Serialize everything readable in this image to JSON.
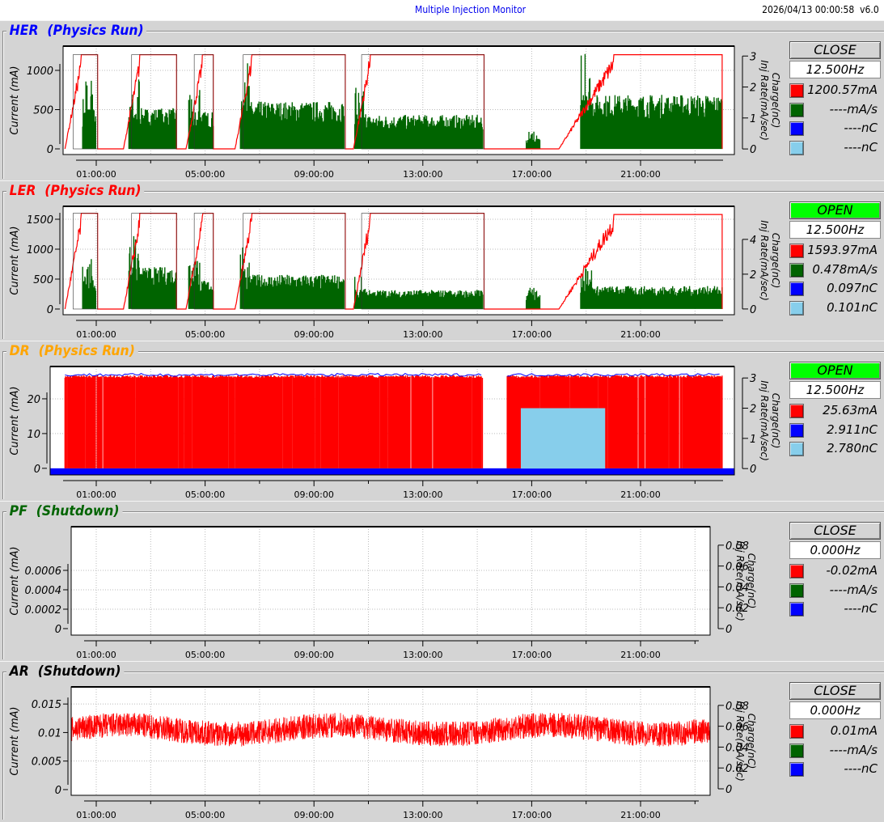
{
  "header": {
    "title": "Multiple Injection Monitor",
    "timestamp": "2026/04/13 00:00:58",
    "version": "v6.0"
  },
  "colors": {
    "current": "#ff0000",
    "inj_rate": "#006400",
    "charge": "#0000ff",
    "charge2": "#87ceeb"
  },
  "time_ticks": [
    {
      "t": 1,
      "label": "01:00:00"
    },
    {
      "t": 5,
      "label": "05:00:00"
    },
    {
      "t": 9,
      "label": "09:00:00"
    },
    {
      "t": 13,
      "label": "13:00:00"
    },
    {
      "t": 17,
      "label": "17:00:00"
    },
    {
      "t": 21,
      "label": "21:00:00"
    }
  ],
  "axis_labels": {
    "left": "Current (mA)",
    "right1": "Charge(nC)",
    "right2": "Inj Rate(mA/sec)"
  },
  "panels": [
    {
      "id": "her",
      "name": "HER",
      "status": "(Physics Run)",
      "color": "#0000ff",
      "state": "CLOSE",
      "freq": "12.500Hz",
      "ylim": [
        -72,
        1309
      ],
      "y2lim": [
        -0.18,
        3.32
      ],
      "yticks": [
        {
          "v": 0,
          "l": "0"
        },
        {
          "v": 500,
          "l": "500"
        },
        {
          "v": 1000,
          "l": "1000"
        }
      ],
      "y2ticks": [
        {
          "v": 0,
          "l": "0"
        },
        {
          "v": 1,
          "l": "1"
        },
        {
          "v": 2,
          "l": "2"
        },
        {
          "v": 3,
          "l": "3"
        }
      ],
      "legend": [
        {
          "color": "#ff0000",
          "value": "1200.57mA"
        },
        {
          "color": "#006400",
          "value": "----mA/s"
        },
        {
          "color": "#0000ff",
          "value": "----nC"
        },
        {
          "color": "#87ceeb",
          "value": "----nC"
        }
      ],
      "fills": [
        [
          -0.15,
          1.05,
          1200
        ],
        [
          2.0,
          3.95,
          1200
        ],
        [
          4.3,
          5.3,
          1200
        ],
        [
          6.1,
          10.15,
          1200
        ],
        [
          10.45,
          15.25,
          1200
        ],
        [
          18.0,
          24.0,
          1200
        ]
      ],
      "inj": [
        [
          0.5,
          1.0,
          1.2
        ],
        [
          2.2,
          3.95,
          1.2
        ],
        [
          4.4,
          5.3,
          1.1
        ],
        [
          6.3,
          10.1,
          1.4
        ],
        [
          10.5,
          15.2,
          1.0
        ],
        [
          16.8,
          17.3,
          0.3
        ],
        [
          18.8,
          24.0,
          1.6
        ]
      ],
      "charge": [
        [
          15.3,
          19.8,
          0.1
        ]
      ]
    },
    {
      "id": "ler",
      "name": "LER",
      "status": "(Physics Run)",
      "color": "#ff0000",
      "state": "OPEN",
      "freq": "12.500Hz",
      "ylim": [
        -95,
        1716
      ],
      "y2lim": [
        -0.33,
        5.9
      ],
      "yticks": [
        {
          "v": 0,
          "l": "0"
        },
        {
          "v": 500,
          "l": "500"
        },
        {
          "v": 1000,
          "l": "1000"
        },
        {
          "v": 1500,
          "l": "1500"
        }
      ],
      "y2ticks": [
        {
          "v": 0,
          "l": "0"
        },
        {
          "v": 2,
          "l": "2"
        },
        {
          "v": 4,
          "l": "4"
        }
      ],
      "legend": [
        {
          "color": "#ff0000",
          "value": "1593.97mA"
        },
        {
          "color": "#006400",
          "value": "0.478mA/s"
        },
        {
          "color": "#0000ff",
          "value": "0.097nC"
        },
        {
          "color": "#87ceeb",
          "value": "0.101nC"
        }
      ],
      "fills": [
        [
          -0.15,
          1.05,
          1600
        ],
        [
          2.0,
          3.95,
          1600
        ],
        [
          4.3,
          5.3,
          1600
        ],
        [
          6.1,
          10.15,
          1600
        ],
        [
          10.45,
          15.25,
          1600
        ],
        [
          18.0,
          24.0,
          1580
        ]
      ],
      "inj": [
        [
          0.5,
          1.0,
          1.5
        ],
        [
          2.2,
          3.95,
          2.2
        ],
        [
          4.4,
          5.3,
          1.5
        ],
        [
          6.3,
          10.1,
          1.8
        ],
        [
          10.5,
          15.2,
          1.0
        ],
        [
          16.8,
          17.3,
          0.8
        ],
        [
          18.8,
          24.0,
          1.2
        ]
      ],
      "charge": [
        [
          15.9,
          17.4,
          0.2
        ],
        [
          23.6,
          24.0,
          0.6
        ]
      ]
    },
    {
      "id": "dr",
      "name": "DR",
      "status": "(Physics Run)",
      "color": "#ffa500",
      "state": "OPEN",
      "freq": "12.500Hz",
      "ylim": [
        -1.9,
        29.3
      ],
      "y2lim": [
        -0.21,
        3.38
      ],
      "yticks": [
        {
          "v": 0,
          "l": "0"
        },
        {
          "v": 10,
          "l": "10"
        },
        {
          "v": 20,
          "l": "20"
        }
      ],
      "y2ticks": [
        {
          "v": 0,
          "l": "0"
        },
        {
          "v": 1,
          "l": "1"
        },
        {
          "v": 2,
          "l": "2"
        },
        {
          "v": 3,
          "l": "3"
        }
      ],
      "legend": [
        {
          "color": "#ff0000",
          "value": "25.63mA"
        },
        {
          "color": "#0000ff",
          "value": "2.911nC"
        },
        {
          "color": "#87ceeb",
          "value": "2.780nC"
        }
      ],
      "dr_fills": [
        [
          -0.15,
          15.2,
          26
        ],
        [
          16.1,
          24.0,
          26
        ]
      ],
      "dr_charge2": [
        [
          16.6,
          19.7,
          2.0
        ]
      ]
    },
    {
      "id": "pf",
      "name": "PF",
      "status": "(Shutdown)",
      "color": "#006400",
      "state": "CLOSE",
      "freq": "0.000Hz",
      "ylim": [
        -6.7e-05,
        0.00105
      ],
      "y2lim": [
        -0.0062,
        0.0977
      ],
      "yticks": [
        {
          "v": 0,
          "l": "0"
        },
        {
          "v": 0.0002,
          "l": "0.0002"
        },
        {
          "v": 0.0004,
          "l": "0.0004"
        },
        {
          "v": 0.0006,
          "l": "0.0006"
        }
      ],
      "y2ticks": [
        {
          "v": 0,
          "l": "0"
        },
        {
          "v": 0.02,
          "l": "0.02"
        },
        {
          "v": 0.04,
          "l": "0.04"
        },
        {
          "v": 0.06,
          "l": "0.06"
        },
        {
          "v": 0.08,
          "l": "0.08"
        }
      ],
      "legend": [
        {
          "color": "#ff0000",
          "value": "-0.02mA"
        },
        {
          "color": "#006400",
          "value": "----mA/s"
        },
        {
          "color": "#0000ff",
          "value": "----nC"
        }
      ]
    },
    {
      "id": "ar",
      "name": "AR",
      "status": "(Shutdown)",
      "color": "#000000",
      "state": "CLOSE",
      "freq": "0.000Hz",
      "ylim": [
        -0.001,
        0.018
      ],
      "y2lim": [
        -0.0062,
        0.0977
      ],
      "yticks": [
        {
          "v": 0,
          "l": "0"
        },
        {
          "v": 0.005,
          "l": "0.005"
        },
        {
          "v": 0.01,
          "l": "0.01"
        },
        {
          "v": 0.015,
          "l": "0.015"
        }
      ],
      "y2ticks": [
        {
          "v": 0,
          "l": "0"
        },
        {
          "v": 0.02,
          "l": "0.02"
        },
        {
          "v": 0.04,
          "l": "0.04"
        },
        {
          "v": 0.06,
          "l": "0.06"
        },
        {
          "v": 0.08,
          "l": "0.08"
        }
      ],
      "legend": [
        {
          "color": "#ff0000",
          "value": "0.01mA"
        },
        {
          "color": "#006400",
          "value": "----mA/s"
        },
        {
          "color": "#0000ff",
          "value": "----nC"
        }
      ],
      "noise": {
        "mean": 0.0105,
        "amp": 0.0022
      }
    }
  ]
}
